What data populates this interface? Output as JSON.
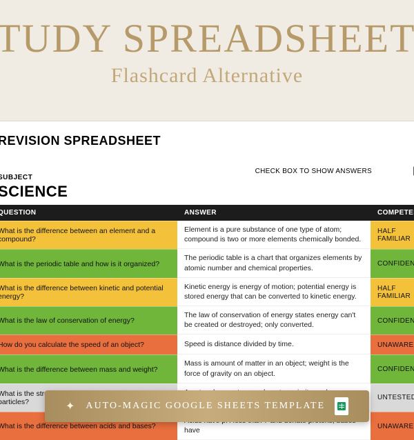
{
  "hero": {
    "title": "STUDY SPREADSHEET",
    "subtitle": "Flashcard Alternative"
  },
  "sheet": {
    "revision_title": "REVISION SPREADSHEET",
    "subject_label": "SUBJECT",
    "subject_value": "SCIENCE",
    "checkbox_label": "CHECK BOX TO SHOW ANSWERS",
    "checked": true,
    "headers": {
      "question": "QUESTION",
      "answer": "ANSWER",
      "competency": "COMPETENCY"
    },
    "rows": [
      {
        "question": "What is the difference between an element and a compound?",
        "answer": "Element is a pure substance of one type of atom; compound is two or more elements chemically bonded.",
        "competency": "HALF FAMILIAR",
        "qcolor": "#f3c13a",
        "ccolor": "#f3c13a"
      },
      {
        "question": "What is the periodic table and how is it organized?",
        "answer": "The periodic table is a chart that organizes elements by atomic number and chemical properties.",
        "competency": "CONFIDENT",
        "qcolor": "#6fb63a",
        "ccolor": "#6fb63a"
      },
      {
        "question": "What is the difference between kinetic and potential energy?",
        "answer": "Kinetic energy is energy of motion; potential energy is stored energy that can be converted to kinetic energy.",
        "competency": "HALF FAMILIAR",
        "qcolor": "#f3c13a",
        "ccolor": "#f3c13a"
      },
      {
        "question": "What is the law of conservation of energy?",
        "answer": "The law of conservation of energy states energy can't be created or destroyed; only converted.",
        "competency": "CONFIDENT",
        "qcolor": "#6fb63a",
        "ccolor": "#6fb63a"
      },
      {
        "question": "How do you calculate the speed of an object?",
        "answer": "Speed is distance divided by time.",
        "competency": "UNAWARE",
        "qcolor": "#e96f3e",
        "ccolor": "#e96f3e"
      },
      {
        "question": "What is the difference between mass and weight?",
        "answer": "Mass is amount of matter in an object; weight is the force of gravity on an object.",
        "competency": "CONFIDENT",
        "qcolor": "#6fb63a",
        "ccolor": "#6fb63a"
      },
      {
        "question": "What is the structure of an atom and its subatomic particles?",
        "answer": "An atom has protons and neutrons in its nucleus, surrounded by electrons.",
        "competency": "UNTESTED",
        "qcolor": "#d9d9d9",
        "ccolor": "#d9d9d9"
      },
      {
        "question": "What is the difference between acids and bases?",
        "answer": "Acids have pH less than 7 and donate protons; bases have",
        "competency": "UNAWARE",
        "qcolor": "#e96f3e",
        "ccolor": "#e96f3e"
      }
    ]
  },
  "footer": {
    "text": "AUTO-MAGIC GOOGLE SHEETS TEMPLATE"
  }
}
